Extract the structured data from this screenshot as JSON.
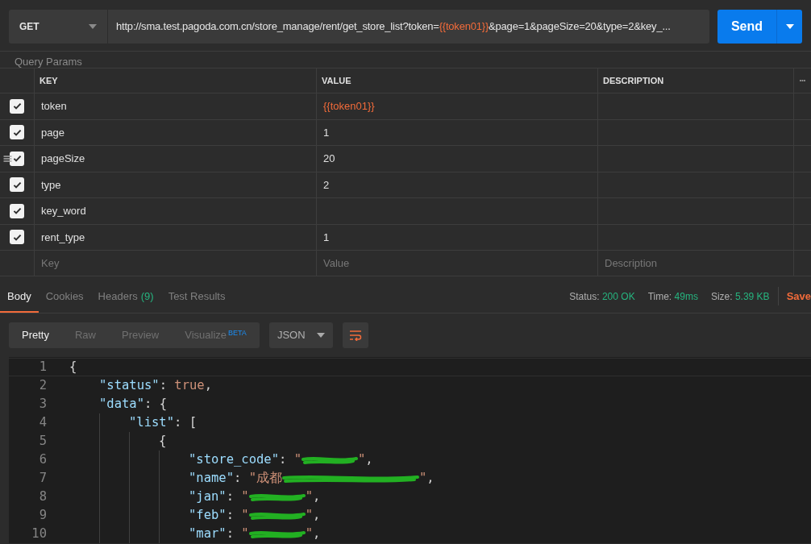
{
  "request": {
    "method": "GET",
    "url_parts": [
      {
        "kind": "plain",
        "text": "http://sma.test.pagoda.com.cn/store_manage/rent/get_store_list?token="
      },
      {
        "kind": "variable",
        "text": "{{token01}}"
      },
      {
        "kind": "plain",
        "text": "&page=1&pageSize=20&type=2&key_..."
      }
    ],
    "send": "Send"
  },
  "params": {
    "title": "Query Params",
    "columns": [
      "KEY",
      "VALUE",
      "DESCRIPTION"
    ],
    "more": "•••",
    "rows": [
      {
        "key": "token",
        "value": "{{token01}}",
        "kind": "variable",
        "checked": true,
        "drag": false
      },
      {
        "key": "page",
        "value": "1",
        "kind": "plain",
        "checked": true,
        "drag": false
      },
      {
        "key": "pageSize",
        "value": "20",
        "kind": "plain",
        "checked": true,
        "drag": true
      },
      {
        "key": "type",
        "value": "2",
        "kind": "plain",
        "checked": true,
        "drag": false
      },
      {
        "key": "key_word",
        "checked": true,
        "drag": false
      },
      {
        "key": "rent_type",
        "value": "1",
        "kind": "plain",
        "checked": true,
        "drag": false
      }
    ],
    "new_row": {
      "key_placeholder": "Key",
      "value_placeholder": "Value",
      "description_placeholder": "Description"
    }
  },
  "response": {
    "tabs": [
      {
        "label": "Body",
        "selected": true
      },
      {
        "label": "Cookies",
        "selected": false
      },
      {
        "label": "Headers",
        "count": "(9)",
        "selected": false
      },
      {
        "label": "Test Results",
        "selected": false
      }
    ],
    "stats": [
      {
        "label": "Status:",
        "value": "200 OK"
      },
      {
        "label": "Time:",
        "value": "49ms"
      },
      {
        "label": "Size:",
        "value": "5.39 KB"
      }
    ],
    "save": "Save",
    "views": [
      {
        "label": "Pretty",
        "selected": true
      },
      {
        "label": "Raw",
        "selected": false
      },
      {
        "label": "Preview",
        "selected": false
      },
      {
        "label": "Visualize",
        "sup": "BETA",
        "selected": false
      }
    ],
    "format": "JSON",
    "lines": [
      {
        "n": "1",
        "parts": [
          {
            "kind": "punct",
            "text": "{"
          }
        ],
        "children": [
          {
            "n": "2",
            "parts": [
              {
                "kind": "key",
                "text": "\"status\""
              },
              {
                "kind": "punct",
                "text": ": "
              },
              {
                "kind": "literal",
                "text": "true"
              },
              {
                "kind": "punct",
                "text": ","
              }
            ]
          },
          {
            "n": "3",
            "parts": [
              {
                "kind": "key",
                "text": "\"data\""
              },
              {
                "kind": "punct",
                "text": ": {"
              }
            ],
            "children": [
              {
                "n": "4",
                "parts": [
                  {
                    "kind": "key",
                    "text": "\"list\""
                  },
                  {
                    "kind": "punct",
                    "text": ": ["
                  }
                ],
                "children": [
                  {
                    "n": "5",
                    "parts": [
                      {
                        "kind": "punct",
                        "text": "{"
                      }
                    ],
                    "children": [
                      {
                        "n": "6",
                        "parts": [
                          {
                            "kind": "key",
                            "text": "\"store_code\""
                          },
                          {
                            "kind": "punct",
                            "text": ": "
                          },
                          {
                            "kind": "string",
                            "text": "\""
                          },
                          {
                            "kind": "redacted"
                          },
                          {
                            "kind": "string",
                            "text": "\""
                          },
                          {
                            "kind": "punct",
                            "text": ","
                          }
                        ]
                      },
                      {
                        "n": "7",
                        "parts": [
                          {
                            "kind": "key",
                            "text": "\"name\""
                          },
                          {
                            "kind": "punct",
                            "text": ": "
                          },
                          {
                            "kind": "string",
                            "text": "\"成都"
                          },
                          {
                            "kind": "redacted_long"
                          },
                          {
                            "kind": "string",
                            "text": "\""
                          },
                          {
                            "kind": "punct",
                            "text": ","
                          }
                        ]
                      },
                      {
                        "n": "8",
                        "parts": [
                          {
                            "kind": "key",
                            "text": "\"jan\""
                          },
                          {
                            "kind": "punct",
                            "text": ": "
                          },
                          {
                            "kind": "string",
                            "text": "\""
                          },
                          {
                            "kind": "redacted"
                          },
                          {
                            "kind": "string",
                            "text": "\""
                          },
                          {
                            "kind": "punct",
                            "text": ","
                          }
                        ]
                      },
                      {
                        "n": "9",
                        "parts": [
                          {
                            "kind": "key",
                            "text": "\"feb\""
                          },
                          {
                            "kind": "punct",
                            "text": ": "
                          },
                          {
                            "kind": "string",
                            "text": "\""
                          },
                          {
                            "kind": "redacted"
                          },
                          {
                            "kind": "string",
                            "text": "\""
                          },
                          {
                            "kind": "punct",
                            "text": ","
                          }
                        ]
                      },
                      {
                        "n": "10",
                        "parts": [
                          {
                            "kind": "key",
                            "text": "\"mar\""
                          },
                          {
                            "kind": "punct",
                            "text": ": "
                          },
                          {
                            "kind": "string",
                            "text": "\""
                          },
                          {
                            "kind": "redacted"
                          },
                          {
                            "kind": "string",
                            "text": "\""
                          },
                          {
                            "kind": "punct",
                            "text": ","
                          }
                        ]
                      }
                    ]
                  }
                ]
              }
            ]
          }
        ]
      }
    ]
  }
}
